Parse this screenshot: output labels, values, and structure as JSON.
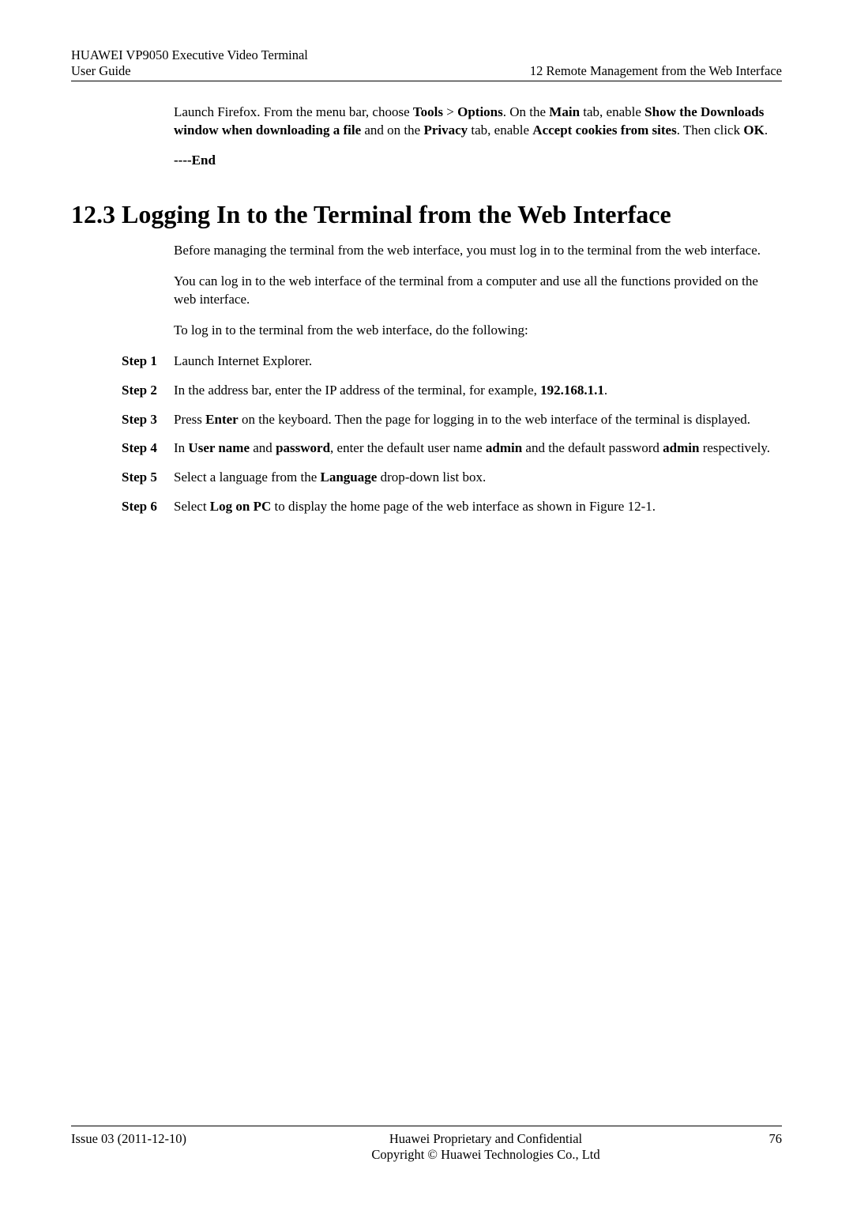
{
  "header": {
    "left_line1": "HUAWEI VP9050 Executive Video Terminal",
    "left_line2": "User Guide",
    "right": "12 Remote Management from the Web Interface"
  },
  "intro_para_html": "Launch Firefox. From the menu bar, choose <b>Tools</b> > <b>Options</b>. On the <b>Main</b> tab, enable <b>Show the Downloads window when downloading a file</b> and on the <b>Privacy</b> tab, enable <b>Accept cookies from sites</b>. Then click <b>OK</b>.",
  "end_mark": "----End",
  "section_heading": "12.3 Logging In to the Terminal from the Web Interface",
  "section_para1": "Before managing the terminal from the web interface, you must log in to the terminal from the web interface.",
  "section_para2": "You can log in to the web interface of the terminal from a computer and use all the functions provided on the web interface.",
  "section_para3": "To log in to the terminal from the web interface, do the following:",
  "steps": [
    {
      "label": "Step 1",
      "html": "Launch Internet Explorer."
    },
    {
      "label": "Step 2",
      "html": "In the address bar, enter the IP address of the terminal, for example, <b>192.168.1.1</b>."
    },
    {
      "label": "Step 3",
      "html": "Press <b>Enter</b> on the keyboard. Then the page for logging in to the web interface of the terminal is displayed."
    },
    {
      "label": "Step 4",
      "html": "In <b>User name</b> and <b>password</b>, enter the default user name <b>admin</b> and the default password <b>admin</b> respectively."
    },
    {
      "label": "Step 5",
      "html": "Select a language from the <b>Language</b> drop-down list box."
    },
    {
      "label": "Step 6",
      "html": "Select <b>Log on PC</b> to display the home page of the web interface as shown in Figure 12-1."
    }
  ],
  "footer": {
    "left": "Issue 03 (2011-12-10)",
    "center_line1": "Huawei Proprietary and Confidential",
    "center_line2": "Copyright © Huawei Technologies Co., Ltd",
    "right": "76"
  }
}
